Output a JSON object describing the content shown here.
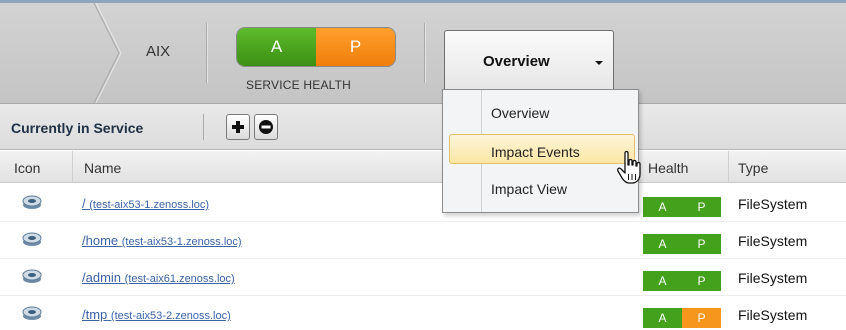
{
  "header": {
    "breadcrumb": "AIX",
    "health": {
      "availability": "A",
      "performance": "P",
      "label": "SERVICE HEALTH"
    },
    "view_selector": {
      "selected": "Overview"
    }
  },
  "toolbar": {
    "title": "Currently in Service",
    "add_icon": "plus-icon",
    "remove_icon": "minus-icon"
  },
  "columns": {
    "icon": "Icon",
    "name": "Name",
    "health": "Health",
    "type": "Type"
  },
  "menu": {
    "items": [
      "Overview",
      "Impact Events",
      "Impact View"
    ],
    "highlighted": "Impact Events"
  },
  "rows": [
    {
      "path": "/",
      "host": "(test-aix53-1.zenoss.loc)",
      "a": "A",
      "p": "P",
      "p_status": "ok",
      "type": "FileSystem"
    },
    {
      "path": "/home",
      "host": "(test-aix53-1.zenoss.loc)",
      "a": "A",
      "p": "P",
      "p_status": "ok",
      "type": "FileSystem"
    },
    {
      "path": "/admin",
      "host": "(test-aix61.zenoss.loc)",
      "a": "A",
      "p": "P",
      "p_status": "ok",
      "type": "FileSystem"
    },
    {
      "path": "/tmp",
      "host": "(test-aix53-2.zenoss.loc)",
      "a": "A",
      "p": "P",
      "p_status": "warning",
      "type": "FileSystem"
    }
  ],
  "colors": {
    "green": "#43a11c",
    "orange": "#f7961c",
    "link": "#3a63a8",
    "menu_highlight": "#fbe6a4"
  }
}
